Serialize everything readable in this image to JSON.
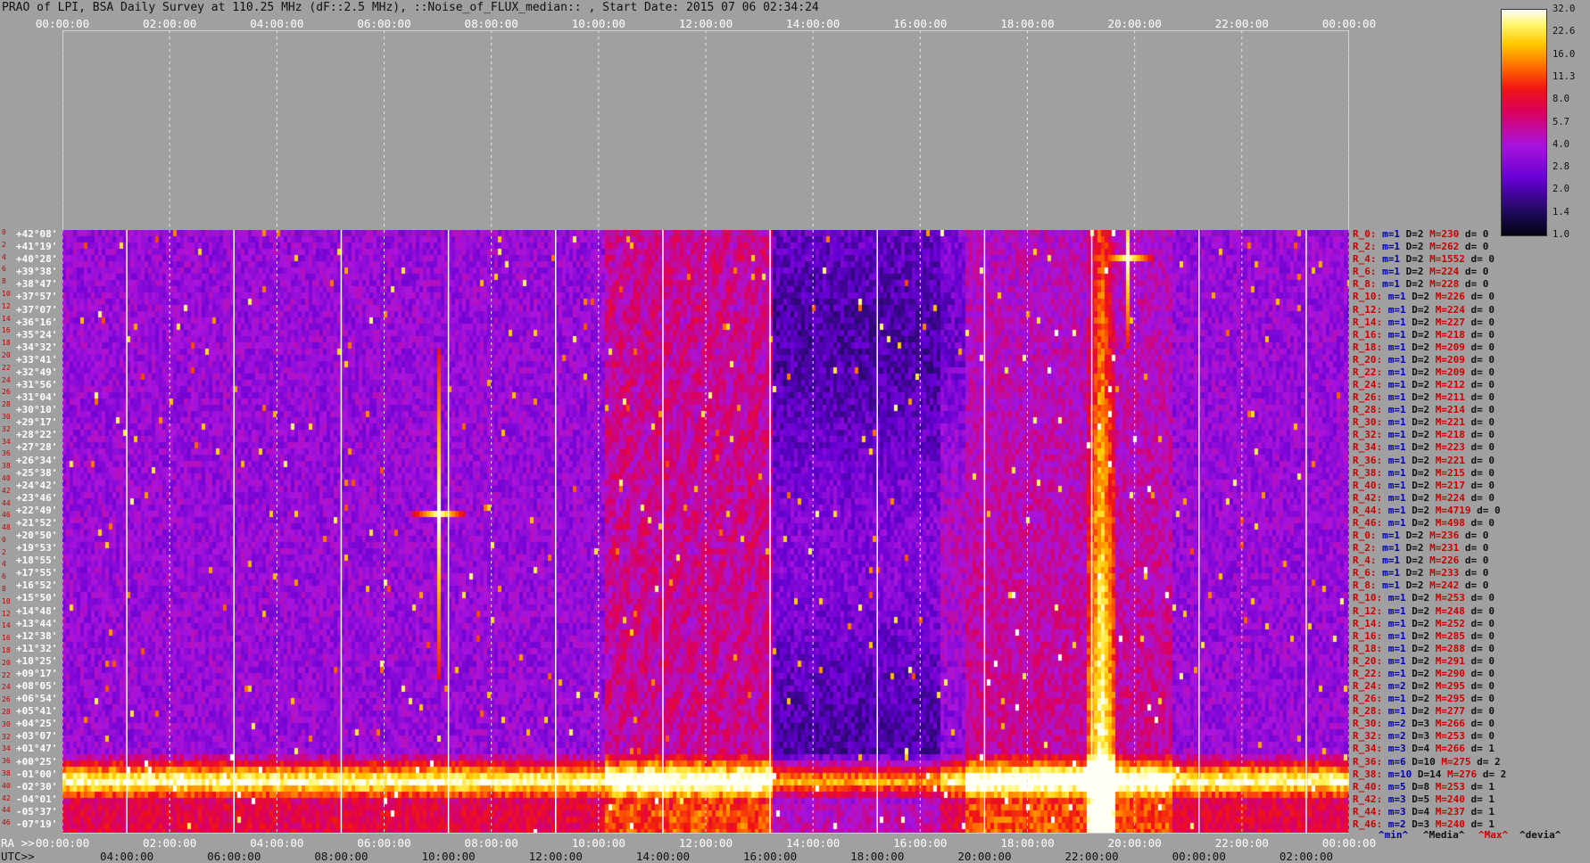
{
  "header": {
    "title": "PRAO of LPI, BSA Daily Survey at 110.25 MHz (dF::2.5 MHz), ::Noise_of_FLUX_median:: , Start Date: 2015 07 06 02:34:24"
  },
  "colors": {
    "background": "#a0a0a0",
    "label_red": "#cc0000",
    "label_blue": "#0000aa",
    "label_dark": "#111111",
    "axis_white": "#ffffff"
  },
  "axes": {
    "top_ticks": [
      "00:00:00",
      "02:00:00",
      "04:00:00",
      "06:00:00",
      "08:00:00",
      "10:00:00",
      "12:00:00",
      "14:00:00",
      "16:00:00",
      "18:00:00",
      "20:00:00",
      "22:00:00",
      "00:00:00"
    ],
    "ra_prefix": "RA >>",
    "utc_prefix": "UTC>>",
    "ra_ticks": [
      "00:00:00",
      "02:00:00",
      "04:00:00",
      "06:00:00",
      "08:00:00",
      "10:00:00",
      "12:00:00",
      "14:00:00",
      "16:00:00",
      "18:00:00",
      "20:00:00",
      "22:00:00",
      "00:00:00"
    ],
    "utc_ticks": [
      "04:00:00",
      "06:00:00",
      "08:00:00",
      "10:00:00",
      "12:00:00",
      "14:00:00",
      "16:00:00",
      "18:00:00",
      "20:00:00",
      "22:00:00",
      "00:00:00",
      "02:00:00"
    ],
    "dec_labels": [
      "+42°08'",
      "+41°19'",
      "+40°28'",
      "+39°38'",
      "+38°47'",
      "+37°57'",
      "+37°07'",
      "+36°16'",
      "+35°24'",
      "+34°32'",
      "+33°41'",
      "+32°49'",
      "+31°56'",
      "+31°04'",
      "+30°10'",
      "+29°17'",
      "+28°22'",
      "+27°28'",
      "+26°34'",
      "+25°38'",
      "+24°42'",
      "+23°46'",
      "+22°49'",
      "+21°52'",
      "+20°50'",
      "+19°53'",
      "+18°55'",
      "+17°55'",
      "+16°52'",
      "+15°50'",
      "+14°48'",
      "+13°44'",
      "+12°38'",
      "+11°32'",
      "+10°25'",
      "+09°17'",
      "+08°05'",
      "+06°54'",
      "+05°41'",
      "+04°25'",
      "+03°07'",
      "+01°47'",
      "+00°25'",
      "-01°00'",
      "-02°30'",
      "-04°01'",
      "-05°37'",
      "-07°19'"
    ],
    "row_indices": [
      "0",
      "2",
      "4",
      "6",
      "8",
      "10",
      "12",
      "14",
      "16",
      "18",
      "20",
      "22",
      "24",
      "26",
      "28",
      "30",
      "32",
      "34",
      "36",
      "38",
      "40",
      "42",
      "44",
      "46",
      "48",
      "0",
      "2",
      "4",
      "6",
      "8",
      "10",
      "12",
      "14",
      "16",
      "18",
      "20",
      "22",
      "24",
      "26",
      "28",
      "30",
      "32",
      "34",
      "36",
      "38",
      "40",
      "42",
      "44",
      "46"
    ]
  },
  "colorbar": {
    "ticks": [
      "32.0",
      "22.6",
      "16.0",
      "11.3",
      "8.0",
      "5.7",
      "4.0",
      "2.8",
      "2.0",
      "1.4",
      "1.0"
    ],
    "scale": "log",
    "min": 1.0,
    "max": 32.0
  },
  "row_stats": [
    {
      "r": "R_0:",
      "m": "1",
      "D": "2",
      "M": "230",
      "d": "0"
    },
    {
      "r": "R_2:",
      "m": "1",
      "D": "2",
      "M": "262",
      "d": "0"
    },
    {
      "r": "R_4:",
      "m": "1",
      "D": "2",
      "M": "1552",
      "d": "0"
    },
    {
      "r": "R_6:",
      "m": "1",
      "D": "2",
      "M": "224",
      "d": "0"
    },
    {
      "r": "R_8:",
      "m": "1",
      "D": "2",
      "M": "228",
      "d": "0"
    },
    {
      "r": "R_10:",
      "m": "1",
      "D": "2",
      "M": "226",
      "d": "0"
    },
    {
      "r": "R_12:",
      "m": "1",
      "D": "2",
      "M": "224",
      "d": "0"
    },
    {
      "r": "R_14:",
      "m": "1",
      "D": "2",
      "M": "227",
      "d": "0"
    },
    {
      "r": "R_16:",
      "m": "1",
      "D": "2",
      "M": "218",
      "d": "0"
    },
    {
      "r": "R_18:",
      "m": "1",
      "D": "2",
      "M": "209",
      "d": "0"
    },
    {
      "r": "R_20:",
      "m": "1",
      "D": "2",
      "M": "209",
      "d": "0"
    },
    {
      "r": "R_22:",
      "m": "1",
      "D": "2",
      "M": "209",
      "d": "0"
    },
    {
      "r": "R_24:",
      "m": "1",
      "D": "2",
      "M": "212",
      "d": "0"
    },
    {
      "r": "R_26:",
      "m": "1",
      "D": "2",
      "M": "211",
      "d": "0"
    },
    {
      "r": "R_28:",
      "m": "1",
      "D": "2",
      "M": "214",
      "d": "0"
    },
    {
      "r": "R_30:",
      "m": "1",
      "D": "2",
      "M": "221",
      "d": "0"
    },
    {
      "r": "R_32:",
      "m": "1",
      "D": "2",
      "M": "218",
      "d": "0"
    },
    {
      "r": "R_34:",
      "m": "1",
      "D": "2",
      "M": "223",
      "d": "0"
    },
    {
      "r": "R_36:",
      "m": "1",
      "D": "2",
      "M": "221",
      "d": "0"
    },
    {
      "r": "R_38:",
      "m": "1",
      "D": "2",
      "M": "215",
      "d": "0"
    },
    {
      "r": "R_40:",
      "m": "1",
      "D": "2",
      "M": "217",
      "d": "0"
    },
    {
      "r": "R_42:",
      "m": "1",
      "D": "2",
      "M": "224",
      "d": "0"
    },
    {
      "r": "R_44:",
      "m": "1",
      "D": "2",
      "M": "4719",
      "d": "0"
    },
    {
      "r": "R_46:",
      "m": "1",
      "D": "2",
      "M": "498",
      "d": "0"
    },
    {
      "r": "R_0:",
      "m": "1",
      "D": "2",
      "M": "236",
      "d": "0"
    },
    {
      "r": "R_2:",
      "m": "1",
      "D": "2",
      "M": "231",
      "d": "0"
    },
    {
      "r": "R_4:",
      "m": "1",
      "D": "2",
      "M": "226",
      "d": "0"
    },
    {
      "r": "R_6:",
      "m": "1",
      "D": "2",
      "M": "233",
      "d": "0"
    },
    {
      "r": "R_8:",
      "m": "1",
      "D": "2",
      "M": "242",
      "d": "0"
    },
    {
      "r": "R_10:",
      "m": "1",
      "D": "2",
      "M": "253",
      "d": "0"
    },
    {
      "r": "R_12:",
      "m": "1",
      "D": "2",
      "M": "248",
      "d": "0"
    },
    {
      "r": "R_14:",
      "m": "1",
      "D": "2",
      "M": "252",
      "d": "0"
    },
    {
      "r": "R_16:",
      "m": "1",
      "D": "2",
      "M": "285",
      "d": "0"
    },
    {
      "r": "R_18:",
      "m": "1",
      "D": "2",
      "M": "288",
      "d": "0"
    },
    {
      "r": "R_20:",
      "m": "1",
      "D": "2",
      "M": "291",
      "d": "0"
    },
    {
      "r": "R_22:",
      "m": "1",
      "D": "2",
      "M": "290",
      "d": "0"
    },
    {
      "r": "R_24:",
      "m": "2",
      "D": "2",
      "M": "295",
      "d": "0"
    },
    {
      "r": "R_26:",
      "m": "1",
      "D": "2",
      "M": "295",
      "d": "0"
    },
    {
      "r": "R_28:",
      "m": "1",
      "D": "2",
      "M": "277",
      "d": "0"
    },
    {
      "r": "R_30:",
      "m": "2",
      "D": "3",
      "M": "266",
      "d": "0"
    },
    {
      "r": "R_32:",
      "m": "2",
      "D": "3",
      "M": "253",
      "d": "0"
    },
    {
      "r": "R_34:",
      "m": "3",
      "D": "4",
      "M": "266",
      "d": "1"
    },
    {
      "r": "R_36:",
      "m": "6",
      "D": "10",
      "M": "275",
      "d": "2"
    },
    {
      "r": "R_38:",
      "m": "10",
      "D": "14",
      "M": "276",
      "d": "2"
    },
    {
      "r": "R_40:",
      "m": "5",
      "D": "8",
      "M": "253",
      "d": "1"
    },
    {
      "r": "R_42:",
      "m": "3",
      "D": "5",
      "M": "240",
      "d": "1"
    },
    {
      "r": "R_44:",
      "m": "3",
      "D": "4",
      "M": "237",
      "d": "1"
    },
    {
      "r": "R_46:",
      "m": "2",
      "D": "3",
      "M": "240",
      "d": "1"
    }
  ],
  "legend_words": [
    "^min^",
    "^Media^",
    "^Max^",
    "^devia^"
  ],
  "chart_data": {
    "type": "heatmap",
    "title": "PRAO of LPI, BSA Daily Survey at 110.25 MHz (dF::2.5 MHz), ::Noise_of_FLUX_median:: , Start Date: 2015 07 06 02:34:24",
    "xlabel": "RA",
    "x2label": "UTC",
    "x_range": [
      "00:00:00",
      "00:00:00"
    ],
    "y_labels_count": 48,
    "y_range": [
      "+42°08'",
      "-07°19'"
    ],
    "color_scale": "log",
    "color_range": [
      1.0,
      32.0
    ],
    "features": [
      {
        "label": "bright source",
        "ra": "07:04",
        "dec": "+23°46'"
      },
      {
        "label": "bright source",
        "ra": "19:59",
        "dec": "+40°28'"
      },
      {
        "label": "bright band",
        "dec_from": "+00°25'",
        "dec_to": "-02°30'"
      },
      {
        "label": "bright column",
        "ra": "19:20"
      }
    ]
  }
}
